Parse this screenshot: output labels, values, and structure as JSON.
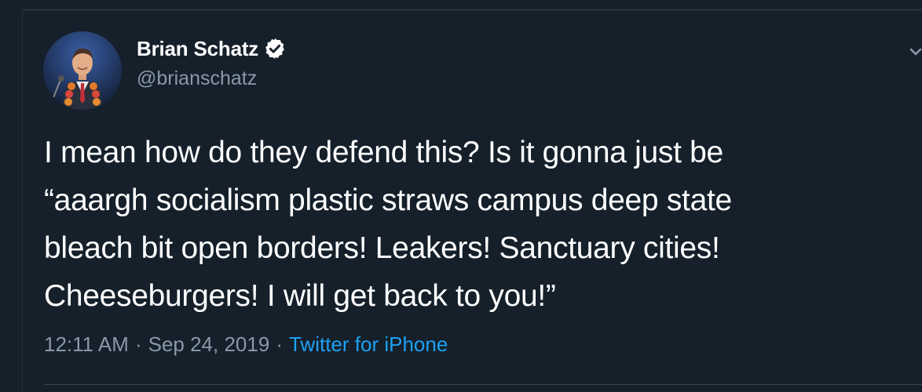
{
  "author": {
    "display_name": "Brian Schatz",
    "handle": "@brianschatz",
    "verified": true
  },
  "tweet": {
    "text_lines": [
      "I mean how do they defend this? Is it gonna just be",
      "“aaargh socialism plastic straws campus deep state",
      "bleach bit open borders! Leakers! Sanctuary cities!",
      "Cheeseburgers! I will get back to you!”"
    ],
    "time": "12:11 AM",
    "separator": "·",
    "date": "Sep 24, 2019",
    "source": "Twitter for iPhone"
  },
  "colors": {
    "background": "#15202b",
    "text": "#ffffff",
    "secondary": "#8899a6",
    "link": "#1da1f2"
  },
  "icons": {
    "verified": "verified-badge-icon",
    "menu": "chevron-down-icon"
  }
}
